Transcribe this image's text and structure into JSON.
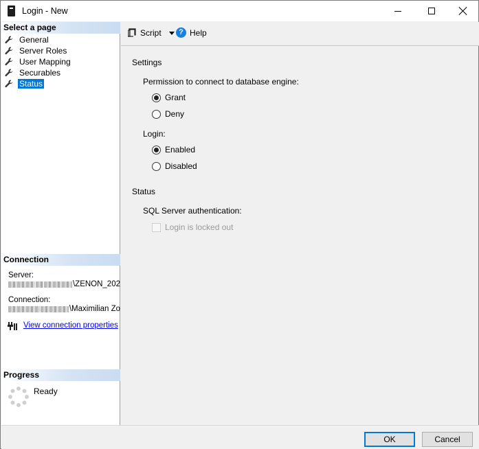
{
  "window": {
    "title": "Login - New"
  },
  "left_panel": {
    "select_page_header": "Select a page",
    "pages": [
      {
        "label": "General",
        "icon": "wrench-icon"
      },
      {
        "label": "Server Roles",
        "icon": "wrench-icon"
      },
      {
        "label": "User Mapping",
        "icon": "wrench-icon"
      },
      {
        "label": "Securables",
        "icon": "wrench-icon"
      },
      {
        "label": "Status",
        "icon": "wrench-icon",
        "selected": true
      }
    ],
    "connection_header": "Connection",
    "server_label": "Server:",
    "server_value_suffix": "\\ZENON_202",
    "connection_label": "Connection:",
    "connection_value_suffix": "\\Maximilian Zo",
    "view_connection_link": "View connection properties",
    "progress_header": "Progress",
    "progress_status": "Ready"
  },
  "toolbar": {
    "script_label": "Script",
    "help_label": "Help"
  },
  "settings": {
    "group_title": "Settings",
    "permission_label": "Permission to connect to database engine:",
    "permission_options": [
      "Grant",
      "Deny"
    ],
    "permission_selected": "Grant",
    "login_label": "Login:",
    "login_options": [
      "Enabled",
      "Disabled"
    ],
    "login_selected": "Enabled"
  },
  "status": {
    "group_title": "Status",
    "auth_label": "SQL Server authentication:",
    "locked_out_label": "Login is locked out",
    "locked_out_checked": false,
    "locked_out_enabled": false
  },
  "buttons": {
    "ok_label": "OK",
    "cancel_label": "Cancel"
  },
  "colors": {
    "selection": "#0078d7",
    "link": "#0000ee",
    "help_icon": "#1e7fd8"
  }
}
